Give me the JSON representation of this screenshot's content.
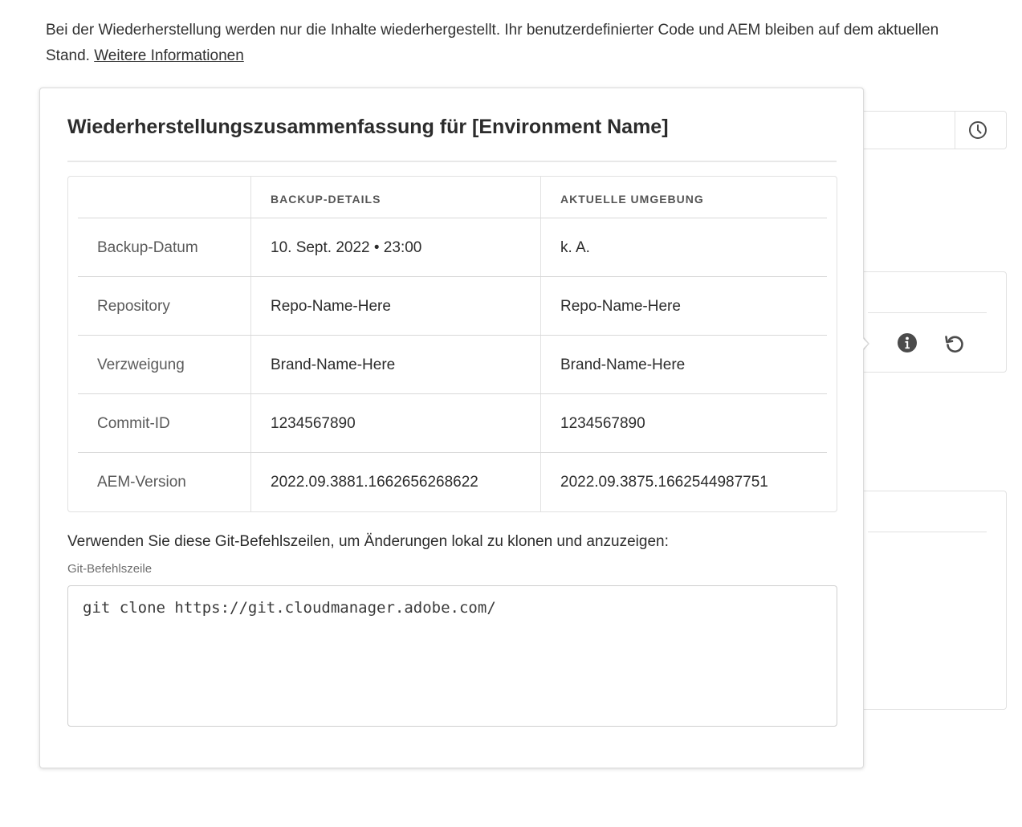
{
  "intro": {
    "text": "Bei der Wiederherstellung werden nur die Inhalte wiederhergestellt. Ihr benutzerdefinierter Code und AEM bleiben auf dem aktuellen Stand.",
    "link": "Weitere Informationen"
  },
  "popover": {
    "title": "Wiederherstellungszusammenfassung für [Environment Name]",
    "table": {
      "headers": [
        "",
        "BACKUP-DETAILS",
        "AKTUELLE UMGEBUNG"
      ],
      "rows": [
        {
          "label": "Backup-Datum",
          "backup": "10. Sept. 2022 • 23:00",
          "current": "k. A."
        },
        {
          "label": "Repository",
          "backup": "Repo-Name-Here",
          "current": "Repo-Name-Here"
        },
        {
          "label": "Verzweigung",
          "backup": "Brand-Name-Here",
          "current": "Brand-Name-Here"
        },
        {
          "label": "Commit-ID",
          "backup": "1234567890",
          "current": "1234567890"
        },
        {
          "label": "AEM-Version",
          "backup": "2022.09.3881.1662656268622",
          "current": "2022.09.3875.1662544987751"
        }
      ]
    },
    "git_intro": "Verwenden Sie diese Git-Befehlszeilen, um Änderungen lokal zu klonen und anzuzeigen:",
    "git_label": "Git-Befehlszeile",
    "git_value": "git clone https://git.cloudmanager.adobe.com/"
  },
  "icons": {
    "history": "clock-icon",
    "info": "info-icon",
    "restore": "restore-icon"
  },
  "colors": {
    "text": "#2c2c2c",
    "muted": "#6e6e6e",
    "border": "#e1e1e1"
  }
}
